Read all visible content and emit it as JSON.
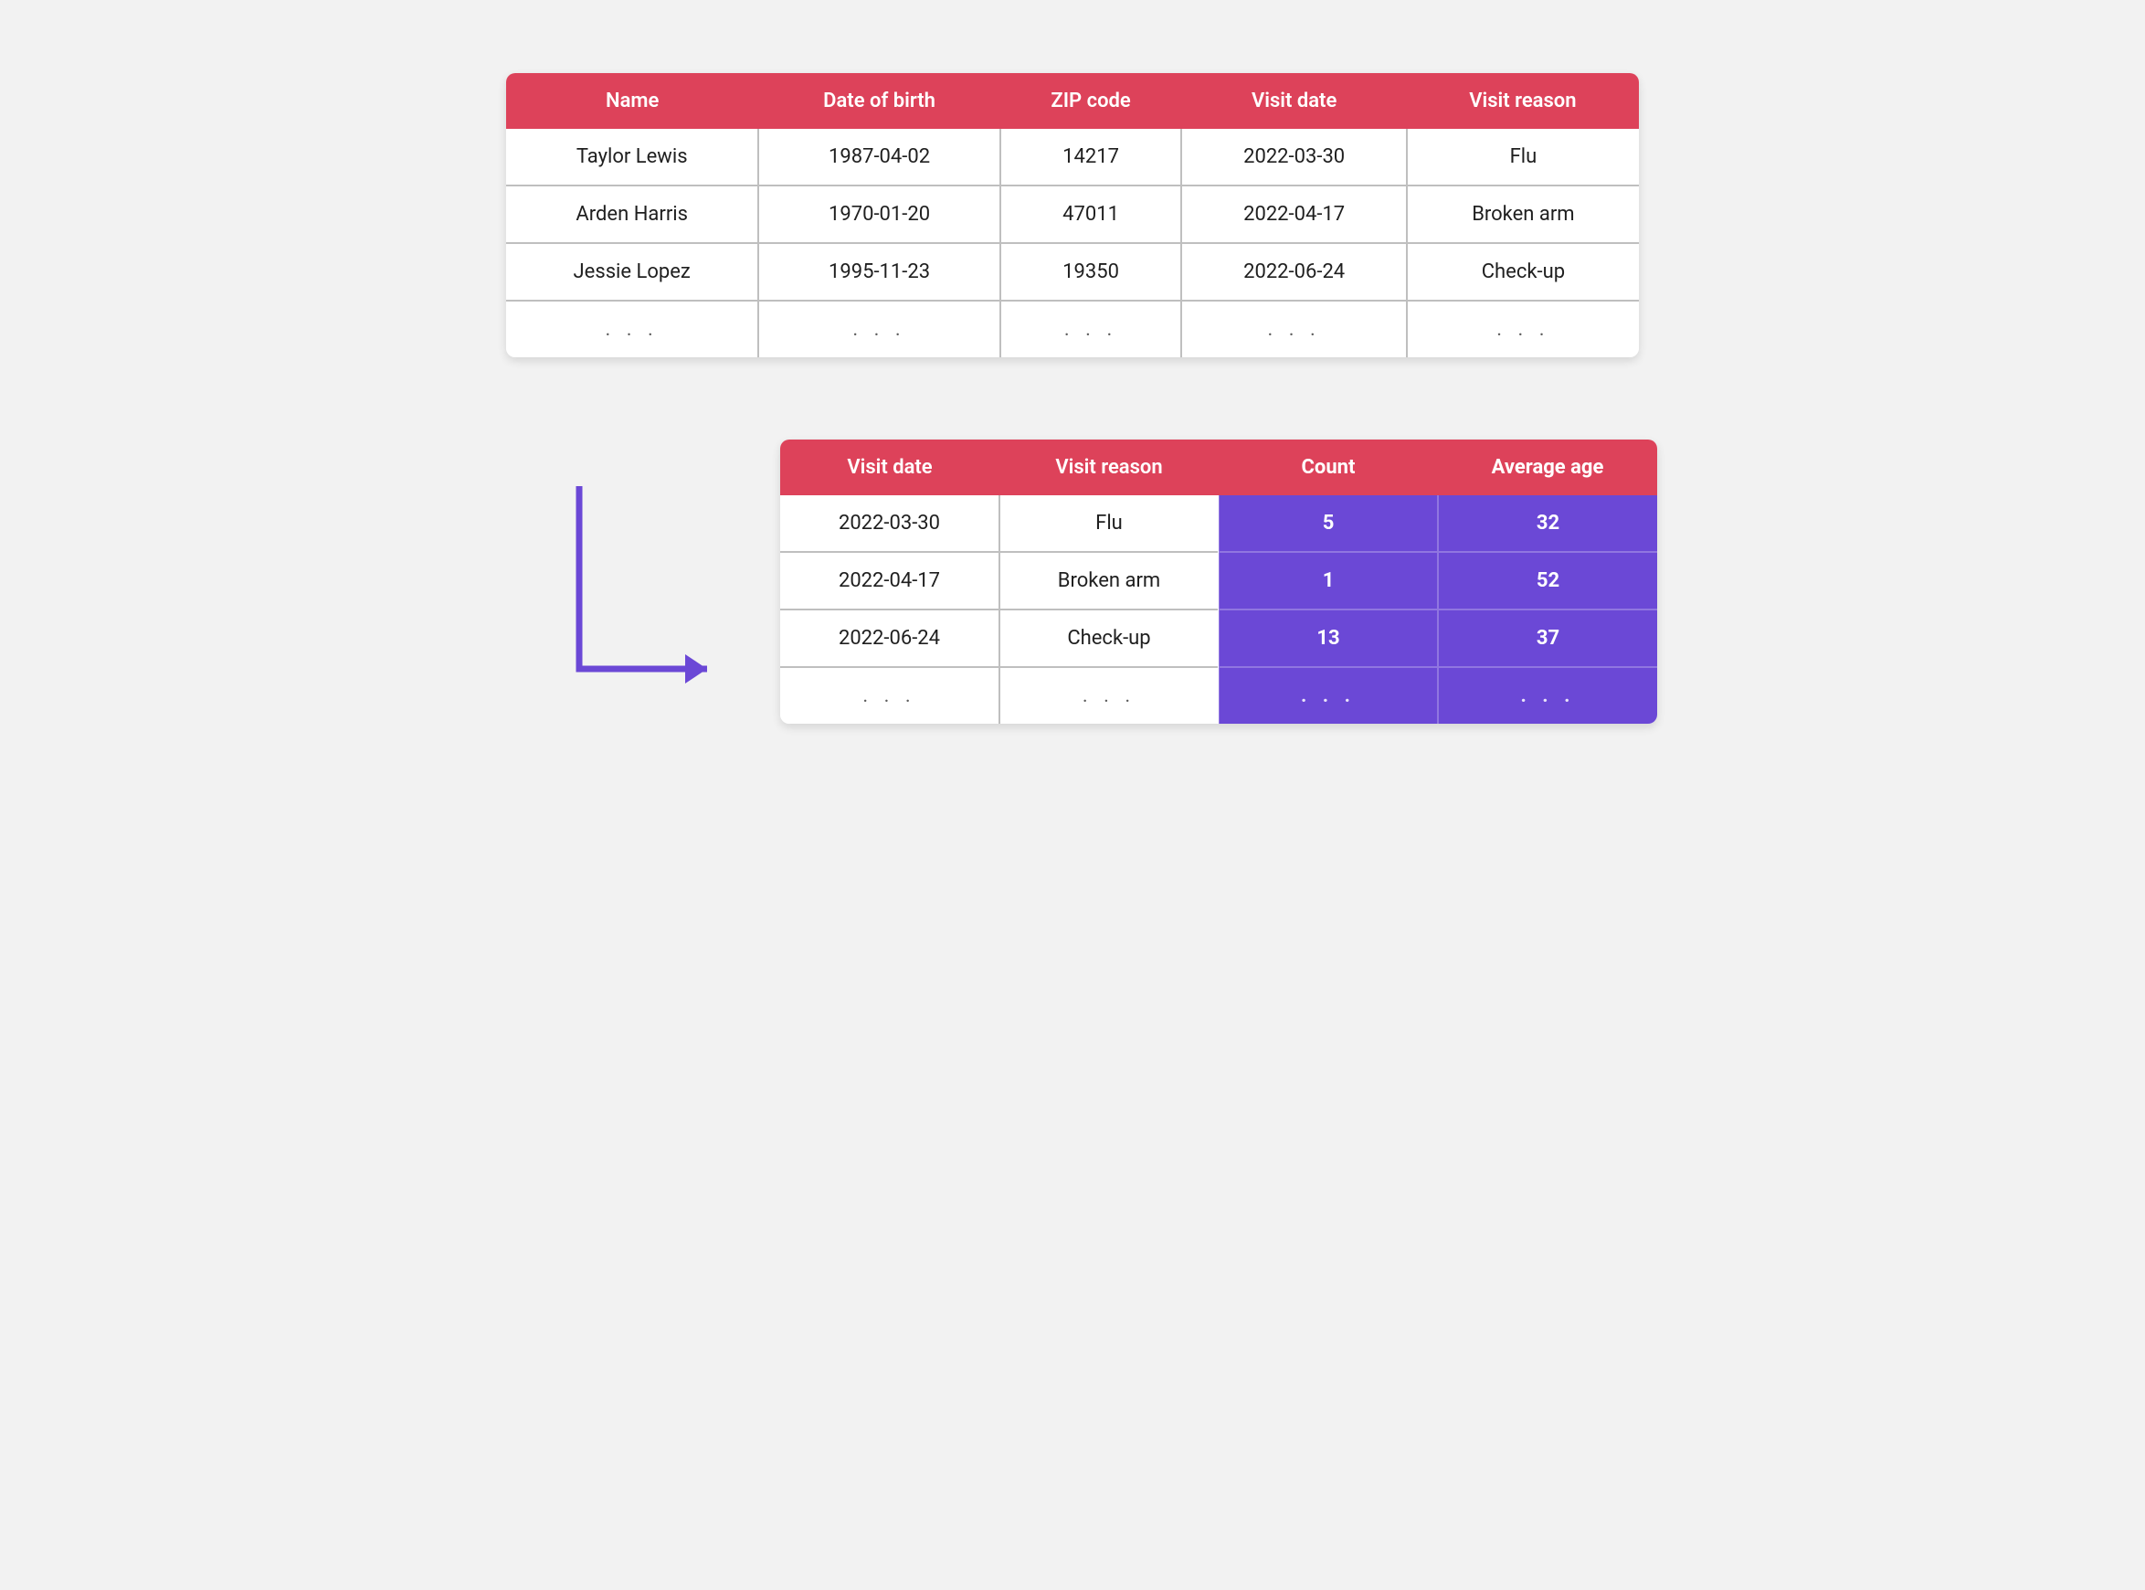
{
  "colors": {
    "header": "#dd425a",
    "aggregate": "#6b48d6",
    "arrow": "#6b48d6",
    "background": "#f2f2f2"
  },
  "source_table": {
    "columns": [
      "Name",
      "Date of birth",
      "ZIP code",
      "Visit date",
      "Visit reason"
    ],
    "rows": [
      [
        "Taylor Lewis",
        "1987-04-02",
        "14217",
        "2022-03-30",
        "Flu"
      ],
      [
        "Arden Harris",
        "1970-01-20",
        "47011",
        "2022-04-17",
        "Broken arm"
      ],
      [
        "Jessie Lopez",
        "1995-11-23",
        "19350",
        "2022-06-24",
        "Check-up"
      ],
      [
        ". . .",
        ". . .",
        ". . .",
        ". . .",
        ". . ."
      ]
    ]
  },
  "result_table": {
    "columns": [
      "Visit date",
      "Visit reason",
      "Count",
      "Average age"
    ],
    "aggregate_columns": [
      2,
      3
    ],
    "rows": [
      [
        "2022-03-30",
        "Flu",
        "5",
        "32"
      ],
      [
        "2022-04-17",
        "Broken arm",
        "1",
        "52"
      ],
      [
        "2022-06-24",
        "Check-up",
        "13",
        "37"
      ],
      [
        ". . .",
        ". . .",
        ". . .",
        ". . ."
      ]
    ]
  }
}
